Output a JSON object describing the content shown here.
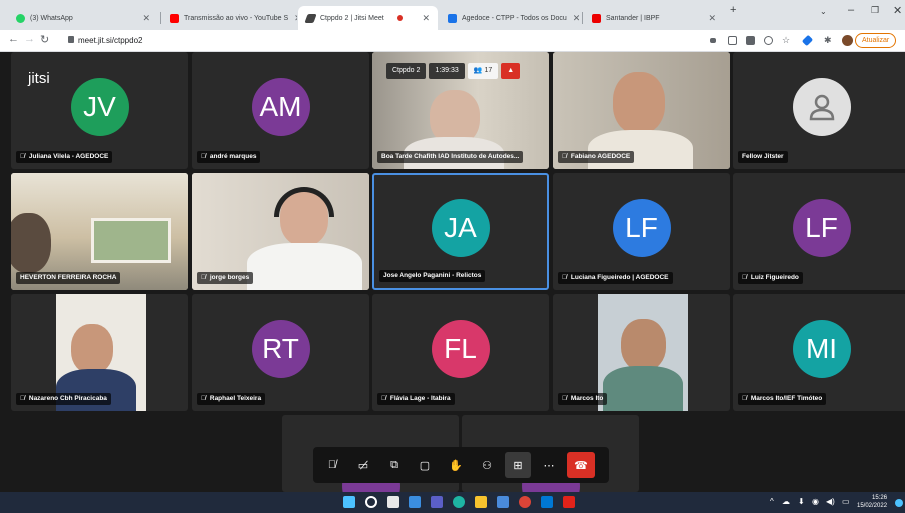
{
  "browser": {
    "tabs": [
      {
        "label": "(3) WhatsApp",
        "color": "#25d366"
      },
      {
        "label": "Transmissão ao vivo - YouTube S",
        "color": "#ff0000"
      },
      {
        "label": "Ctppdo 2 | Jitsi Meet",
        "color": "#444444"
      },
      {
        "label": "Agedoce - CTPP - Todos os Docu",
        "color": "#1a73e8"
      },
      {
        "label": "Santander | IBPF",
        "color": "#ec0000"
      }
    ],
    "url": "meet.jit.si/ctppdo2",
    "update_label": "Atualizar"
  },
  "meeting": {
    "logo": "jitsi",
    "room": "Ctppdo 2",
    "timer": "1:39:33",
    "participants_count": "17",
    "tiles": [
      {
        "name": "Juliana Vilela - AGEDOCE",
        "initials": "JV",
        "color": "#1e9e5b"
      },
      {
        "name": "andré marques",
        "initials": "AM",
        "color": "#7b3a96"
      },
      {
        "name": "Boa Tarde Chafith IAD Instituto de Autodes...",
        "initials": "",
        "color": ""
      },
      {
        "name": "Fabiano AGEDOCE",
        "initials": "",
        "color": ""
      },
      {
        "name": "Fellow Jitster",
        "initials": "",
        "color": "#e0e0e0"
      },
      {
        "name": "HEVERTON FERREIRA ROCHA",
        "initials": "",
        "color": ""
      },
      {
        "name": "jorge borges",
        "initials": "",
        "color": ""
      },
      {
        "name": "Jose Angelo Paganini - Relictos",
        "initials": "JA",
        "color": "#14a3a3"
      },
      {
        "name": "Luciana Figueiredo | AGEDOCE",
        "initials": "LF",
        "color": "#2d7be0"
      },
      {
        "name": "Luiz Figueiredo",
        "initials": "LF",
        "color": "#7b3a96"
      },
      {
        "name": "Nazareno Cbh Piracicaba",
        "initials": "",
        "color": ""
      },
      {
        "name": "Raphael Teixeira",
        "initials": "RT",
        "color": "#7b3a96"
      },
      {
        "name": "Flávia Lage - Itabira",
        "initials": "FL",
        "color": "#d8386a"
      },
      {
        "name": "Marcos Ito",
        "initials": "",
        "color": ""
      },
      {
        "name": "Marcos Ito/IEF Timóteo",
        "initials": "MI",
        "color": "#14a3a3"
      }
    ]
  },
  "taskbar": {
    "time": "15:26",
    "date": "15/02/2022"
  }
}
